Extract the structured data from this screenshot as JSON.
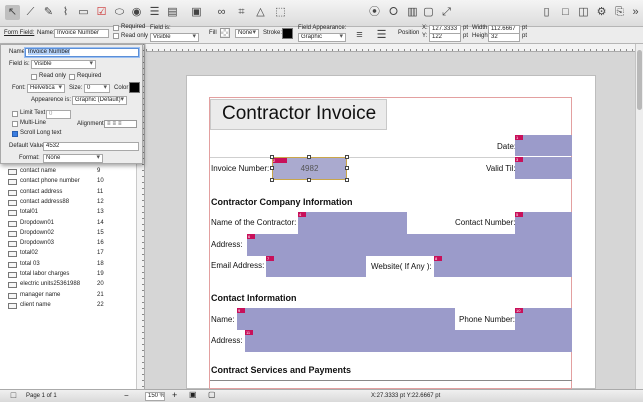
{
  "properties_bar": {
    "form_field_label": "Form Field:",
    "name_label": "Name:",
    "name_value": "Invoice Number",
    "required_label": "Required",
    "read_only_label": "Read only",
    "field_is_label": "Field is:",
    "field_is_value": "Visible",
    "fill_label": "Fill",
    "none_value": "None",
    "stroke_label": "Stroke:",
    "field_appearance_label": "Field Appearance:",
    "field_appearance_value": "Graphic",
    "position_label": "Position",
    "x_label": "X:",
    "x_value": "127.3333",
    "y_label": "Y:",
    "y_value": "122",
    "width_label": "Width:",
    "width_value": "112.6667",
    "height_label": "Height:",
    "height_value": "32",
    "unit": "pt"
  },
  "panel": {
    "name_label": "Name:",
    "name_value": "Invoice Number",
    "field_is_label": "Field is:",
    "field_is_value": "Visible",
    "read_only_label": "Read only",
    "required_label": "Required",
    "font_label": "Font:",
    "font_value": "Helvetica",
    "size_label": "Size:",
    "size_value": "0",
    "color_label": "Color",
    "appearance_label": "Appearence is:",
    "appearance_value": "Graphic (Default)",
    "limit_text_label": "Limit Text",
    "limit_text_value": "0",
    "multi_line_label": "Multi-Line",
    "alignment_label": "Alignment:",
    "scroll_label": "Scroll Long text",
    "default_value_label": "Default Value",
    "default_value": "4532",
    "format_label": "Format:",
    "format_value": "None"
  },
  "field_list": [
    {
      "name": "contact name",
      "num": "9"
    },
    {
      "name": "contact phone number",
      "num": "10"
    },
    {
      "name": "contact address",
      "num": "11"
    },
    {
      "name": "contact address88",
      "num": "12"
    },
    {
      "name": "total01",
      "num": "13"
    },
    {
      "name": "Dropdown01",
      "num": "14"
    },
    {
      "name": "Dropdown02",
      "num": "15"
    },
    {
      "name": "Dropdown03",
      "num": "16"
    },
    {
      "name": "total02",
      "num": "17"
    },
    {
      "name": "total 03",
      "num": "18"
    },
    {
      "name": "total labor charges",
      "num": "19"
    },
    {
      "name": "electric units25361988",
      "num": "20"
    },
    {
      "name": "manager name",
      "num": "21"
    },
    {
      "name": "client name",
      "num": "22"
    }
  ],
  "form": {
    "title": "Contractor Invoice",
    "date_label": "Date:",
    "invoice_number_label": "Invoice Number:",
    "invoice_number_value": "4982",
    "valid_till_label": "Valid Til:",
    "company_heading": "Contractor Company Information",
    "contractor_name_label": "Name of the Contractor:",
    "contact_number_label": "Contact Number:",
    "address_label": "Address:",
    "email_label": "Email Address:",
    "website_label": "Website( If Any ):",
    "contact_heading": "Contact Information",
    "name_label": "Name:",
    "phone_label": "Phone Number:",
    "contact_address_label": "Address:",
    "services_heading": "Contract Services and Payments",
    "tags": {
      "date": "1",
      "valid": "3",
      "sel": "2",
      "contractor": "4",
      "contact_number": "5",
      "address": "6",
      "email": "7",
      "website": "8",
      "name": "9",
      "phone": "10",
      "contact_address": "11"
    }
  },
  "status": {
    "page_label": "Page 1 of 1",
    "zoom": "150 %",
    "coords": "X:27.3333 pt  Y:22.6667 pt"
  },
  "colors": {
    "field_fill": "#9b9bca",
    "tag": "#c8105a",
    "selection_border": "#c9a64a"
  }
}
